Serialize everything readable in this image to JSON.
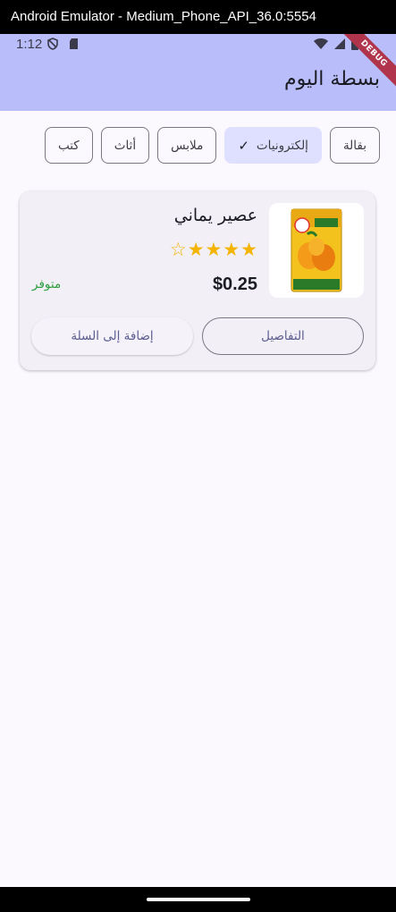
{
  "window": {
    "title": "Android Emulator - Medium_Phone_API_36.0:5554"
  },
  "status_bar": {
    "time": "1:12"
  },
  "app_bar": {
    "title": "بسطة اليوم",
    "debug_label": "DEBUG"
  },
  "chips": [
    {
      "label": "بقالة",
      "selected": false
    },
    {
      "label": "إلكترونيات",
      "selected": true
    },
    {
      "label": "ملابس",
      "selected": false
    },
    {
      "label": "أثاث",
      "selected": false
    },
    {
      "label": "كتب",
      "selected": false
    }
  ],
  "product": {
    "name": "عصير يماني",
    "rating": 4,
    "rating_max": 5,
    "price": "$0.25",
    "stock": "متوفر",
    "image_label": "شراب المانجو",
    "details_label": "التفاصيل",
    "add_to_cart_label": "إضافة إلى السلة"
  },
  "colors": {
    "accent": "#b9bdf9",
    "chip_selected": "#dfe0ff",
    "star": "#f4b400",
    "in_stock": "#2e9e3e"
  }
}
